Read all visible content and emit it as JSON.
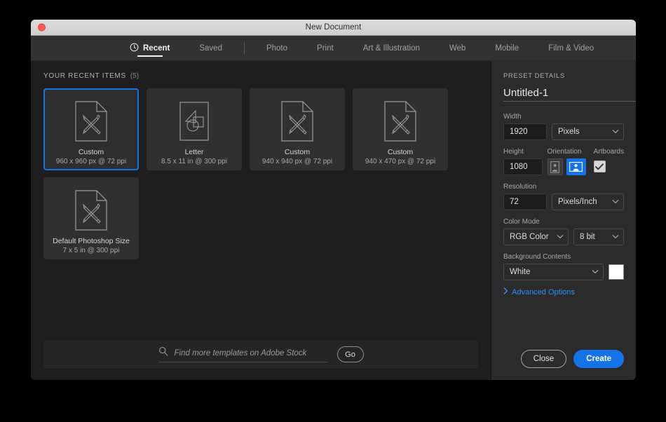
{
  "window": {
    "title": "New Document",
    "close_dot": "close-window-dot"
  },
  "tabs": [
    {
      "label": "Recent",
      "icon": "clock-icon",
      "active": true
    },
    {
      "label": "Saved",
      "active": false
    },
    {
      "label": "Photo",
      "active": false
    },
    {
      "label": "Print",
      "active": false
    },
    {
      "label": "Art & Illustration",
      "active": false
    },
    {
      "label": "Web",
      "active": false
    },
    {
      "label": "Mobile",
      "active": false
    },
    {
      "label": "Film & Video",
      "active": false
    }
  ],
  "recent": {
    "header": "YOUR RECENT ITEMS",
    "count": "(5)",
    "items": [
      {
        "title": "Custom",
        "subtitle": "960 x 960 px @ 72 ppi",
        "icon": "document-pencil-icon",
        "selected": true
      },
      {
        "title": "Letter",
        "subtitle": "8.5 x 11 in @ 300 ppi",
        "icon": "print-shapes-icon",
        "selected": false
      },
      {
        "title": "Custom",
        "subtitle": "940 x 940 px @ 72 ppi",
        "icon": "document-pencil-icon",
        "selected": false
      },
      {
        "title": "Custom",
        "subtitle": "940 x 470 px @ 72 ppi",
        "icon": "document-pencil-icon",
        "selected": false
      },
      {
        "title": "Default Photoshop Size",
        "subtitle": "7 x 5 in @ 300 ppi",
        "icon": "document-pencil-icon",
        "selected": false
      }
    ]
  },
  "stock": {
    "placeholder": "Find more templates on Adobe Stock",
    "value": "",
    "go_label": "Go",
    "search_icon": "search-icon"
  },
  "preset": {
    "section_label": "PRESET DETAILS",
    "doc_name": "Untitled-1",
    "save_preset_icon": "save-preset-icon",
    "width_label": "Width",
    "width_value": "1920",
    "width_unit": "Pixels",
    "height_label": "Height",
    "height_value": "1080",
    "orientation_label": "Orientation",
    "orientation_portrait": "portrait-orientation-icon",
    "orientation_landscape": "landscape-orientation-icon",
    "orientation_selected": "landscape",
    "artboards_label": "Artboards",
    "artboards_checked": true,
    "resolution_label": "Resolution",
    "resolution_value": "72",
    "resolution_unit": "Pixels/Inch",
    "color_mode_label": "Color Mode",
    "color_mode_value": "RGB Color",
    "color_depth_value": "8 bit",
    "background_label": "Background Contents",
    "background_value": "White",
    "background_swatch": "#ffffff",
    "advanced_options": "Advanced Options"
  },
  "footer": {
    "close_label": "Close",
    "create_label": "Create"
  },
  "colors": {
    "accent": "#1473e6",
    "panel": "#2b2b2b",
    "content": "#1e1e1e",
    "tabbar": "#323232",
    "card": "#303030",
    "link": "#2f8eff"
  }
}
